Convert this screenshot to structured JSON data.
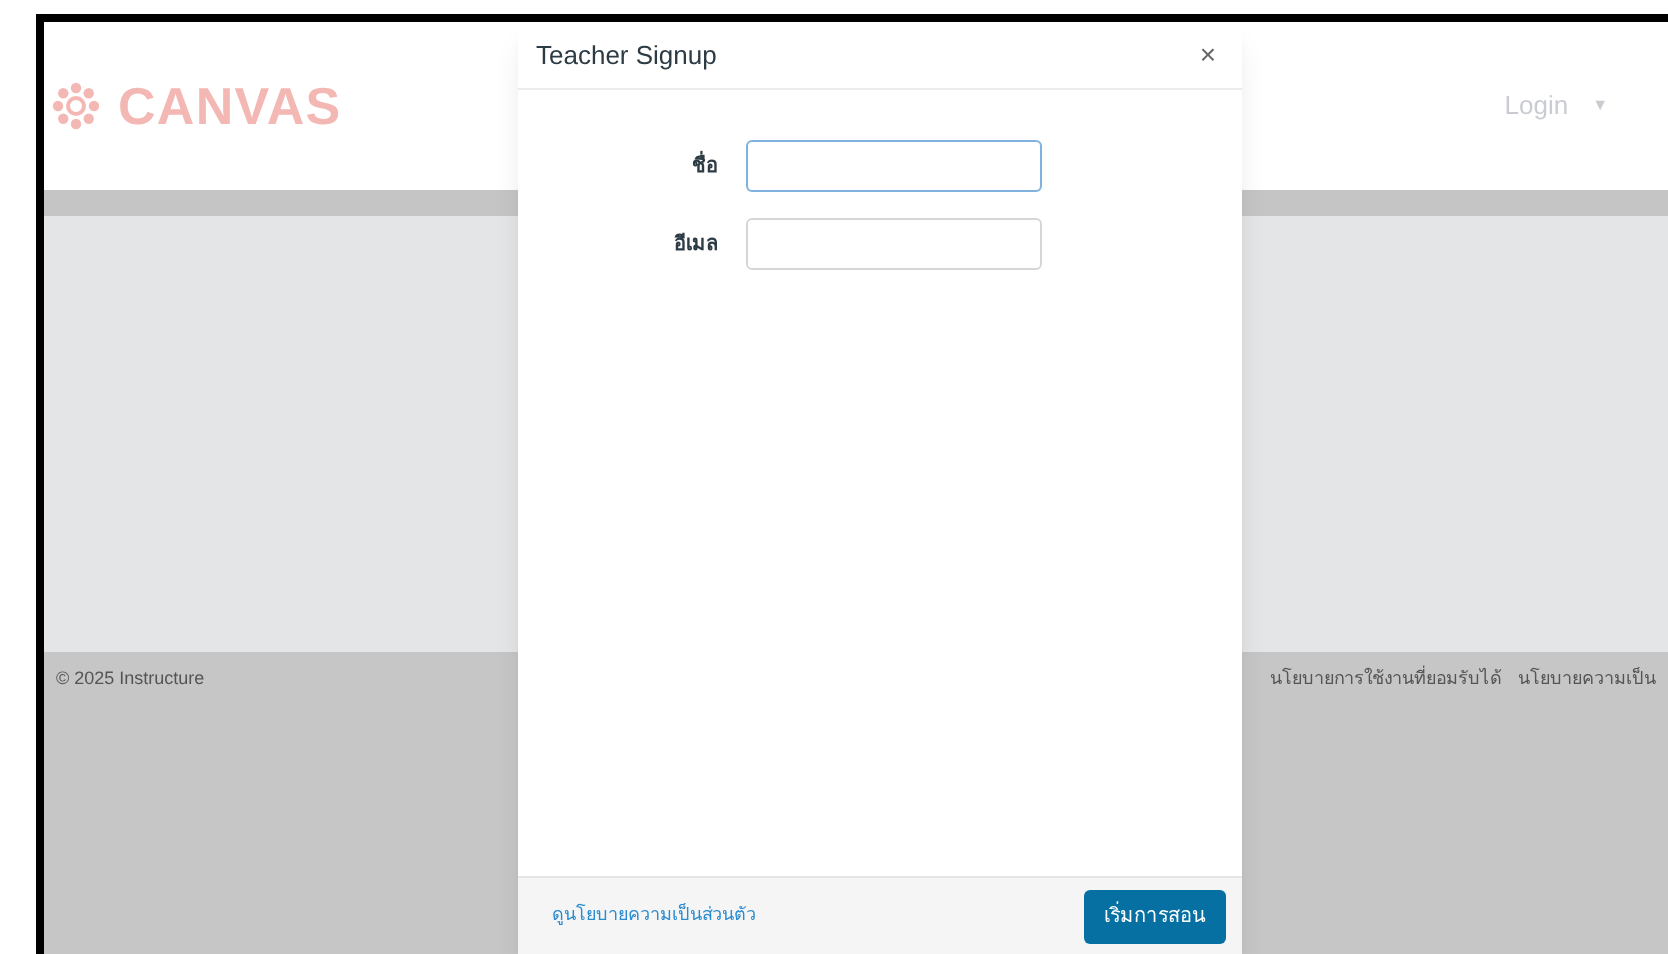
{
  "header": {
    "logo": "CANVAS",
    "login": "Login",
    "login_caret": "▼"
  },
  "footer": {
    "copyright": "© 2025  Instructure",
    "links": [
      "นโยบายการใช้งานที่ยอมรับได้",
      "นโยบายความเป็น"
    ]
  },
  "dialog": {
    "title": "Teacher Signup",
    "close": "×",
    "fields": [
      {
        "label": "ชื่อ",
        "focused": true
      },
      {
        "label": "อีเมล",
        "focused": false
      }
    ],
    "privacy_link": "ดูนโยบายความเป็นส่วนตัว",
    "submit": "เริ่มการสอน"
  }
}
